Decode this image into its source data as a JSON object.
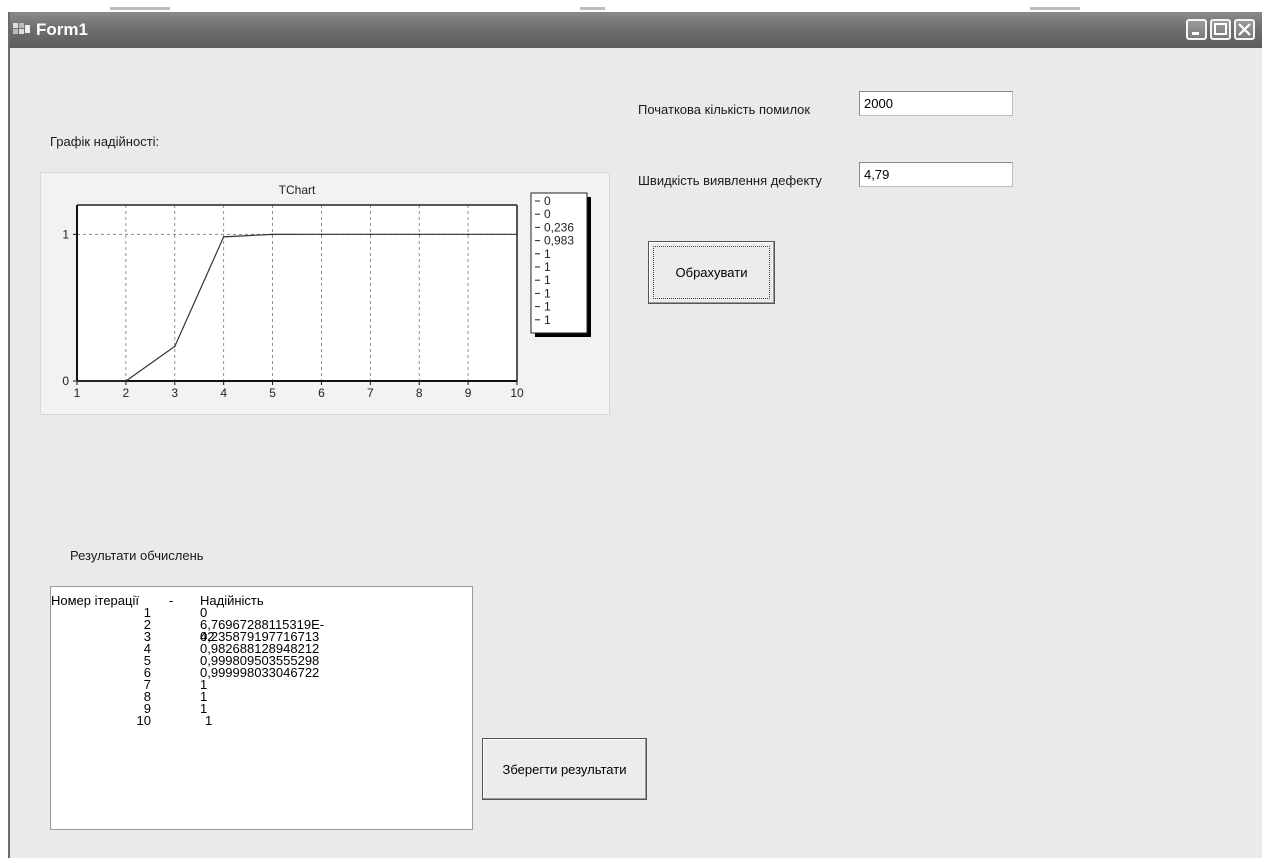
{
  "window": {
    "title": "Form1"
  },
  "inputs": {
    "initial_errors_label": "Початкова кількість помилок",
    "initial_errors_value": "2000",
    "detection_rate_label": "Швидкість виявлення дефекту",
    "detection_rate_value": "4,79"
  },
  "buttons": {
    "calculate": "Обрахувати",
    "save": "Зберегти результати"
  },
  "chart_section": {
    "label": "Графік надійності:"
  },
  "chart_data": {
    "type": "line",
    "title": "TChart",
    "x": [
      1,
      2,
      3,
      4,
      5,
      6,
      7,
      8,
      9,
      10
    ],
    "values": [
      0,
      6.76967288115319e-42,
      0.235879197716713,
      0.982688128948212,
      0.999809503555298,
      0.999998033046722,
      1,
      1,
      1,
      1
    ],
    "x_ticks": [
      "1",
      "2",
      "3",
      "4",
      "5",
      "6",
      "7",
      "8",
      "9",
      "10"
    ],
    "y_ticks": [
      "0",
      "1"
    ],
    "legend": [
      "0",
      "0",
      "0,236",
      "0,983",
      "1",
      "1",
      "1",
      "1",
      "1",
      "1"
    ],
    "ylim": [
      0,
      1.2
    ],
    "grid": true,
    "legend_position": "right"
  },
  "results": {
    "label": "Результати обчислень",
    "header_iteration": "Номер ітерації",
    "header_sep": "-",
    "header_reliability": "Надійність",
    "rows": [
      {
        "n": "1",
        "v": "0"
      },
      {
        "n": "2",
        "v": "6,76967288115319E-42"
      },
      {
        "n": "3",
        "v": "0,235879197716713"
      },
      {
        "n": "4",
        "v": "0,982688128948212"
      },
      {
        "n": "5",
        "v": "0,999809503555298"
      },
      {
        "n": "6",
        "v": "0,999998033046722"
      },
      {
        "n": "7",
        "v": "1"
      },
      {
        "n": "8",
        "v": "1"
      },
      {
        "n": "9",
        "v": "1"
      },
      {
        "n": "10",
        "v": "1"
      }
    ]
  }
}
